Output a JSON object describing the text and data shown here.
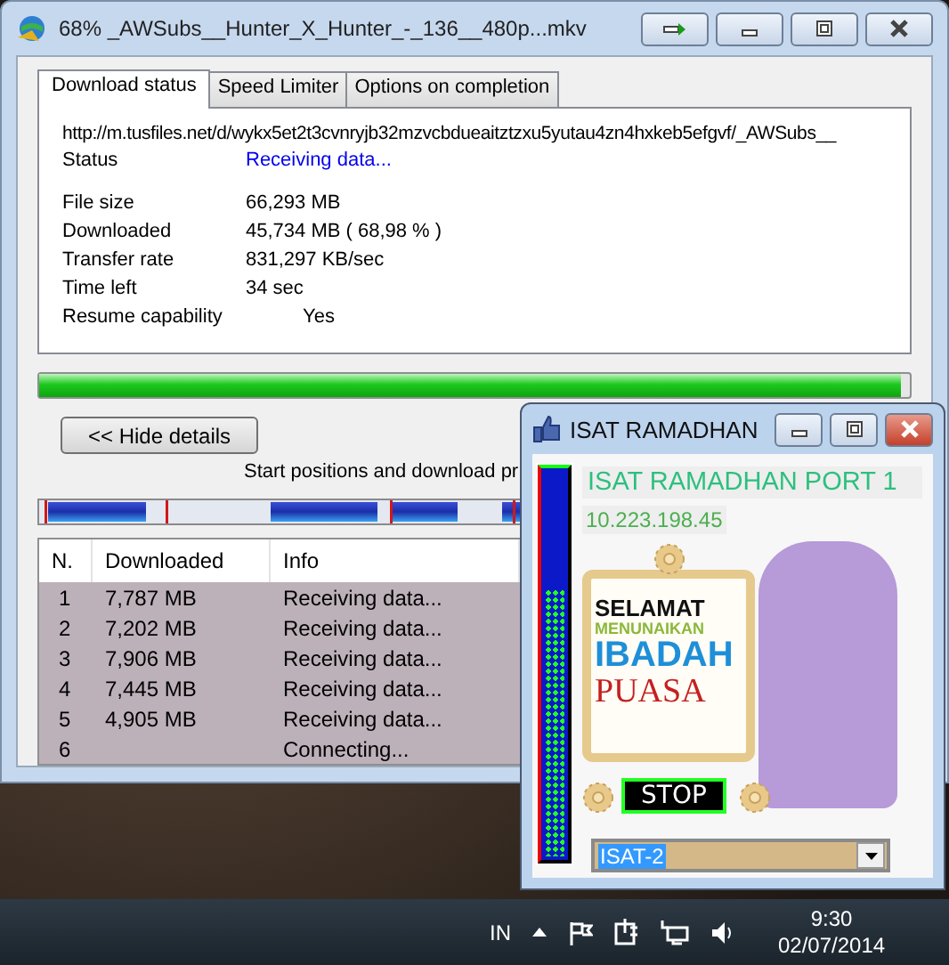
{
  "download_window": {
    "title": "68% _AWSubs__Hunter_X_Hunter_-_136__480p...mkv",
    "tabs": [
      {
        "label": "Download status",
        "selected": true
      },
      {
        "label": "Speed Limiter",
        "selected": false
      },
      {
        "label": "Options on completion",
        "selected": false
      }
    ],
    "url": "http://m.tusfiles.net/d/wykx5et2t3cvnryjb32mzvcbdueaitztzxu5yutau4zn4hxkeb5efgvf/_AWSubs__",
    "status": {
      "label": "Status",
      "value": "Receiving data..."
    },
    "details": [
      {
        "label": "File size",
        "value": "66,293  MB"
      },
      {
        "label": "Downloaded",
        "value": "45,734  MB  ( 68,98 % )"
      },
      {
        "label": "Transfer rate",
        "value": "831,297  KB/sec"
      },
      {
        "label": "Time left",
        "value": "34 sec"
      },
      {
        "label": "Resume capability",
        "value": "Yes"
      }
    ],
    "progress": {
      "level": 0.99
    },
    "hide_details_button": "<< Hide details",
    "segments_caption": "Start positions and download pr",
    "connections": {
      "columns": [
        "N.",
        "Downloaded",
        "Info"
      ],
      "rows": [
        [
          "1",
          "7,787  MB",
          "Receiving data..."
        ],
        [
          "2",
          "7,202  MB",
          "Receiving data..."
        ],
        [
          "3",
          "7,906  MB",
          "Receiving data..."
        ],
        [
          "4",
          "7,445  MB",
          "Receiving data..."
        ],
        [
          "5",
          "4,905  MB",
          "Receiving data..."
        ],
        [
          "6",
          "",
          "Connecting..."
        ]
      ]
    }
  },
  "isat_window": {
    "title": "ISAT RAMADHAN",
    "heading": "ISAT RAMADHAN PORT 1",
    "ip": "10.223.198.45",
    "meter": {
      "level": 0.7
    },
    "banner": [
      "SELAMAT",
      "MENUNAIKAN",
      "IBADAH",
      "PUASA"
    ],
    "stop_button": "STOP",
    "server_select": {
      "value": "ISAT-2"
    }
  },
  "taskbar": {
    "language": "IN",
    "time": "9:30",
    "date": "02/07/2014"
  }
}
